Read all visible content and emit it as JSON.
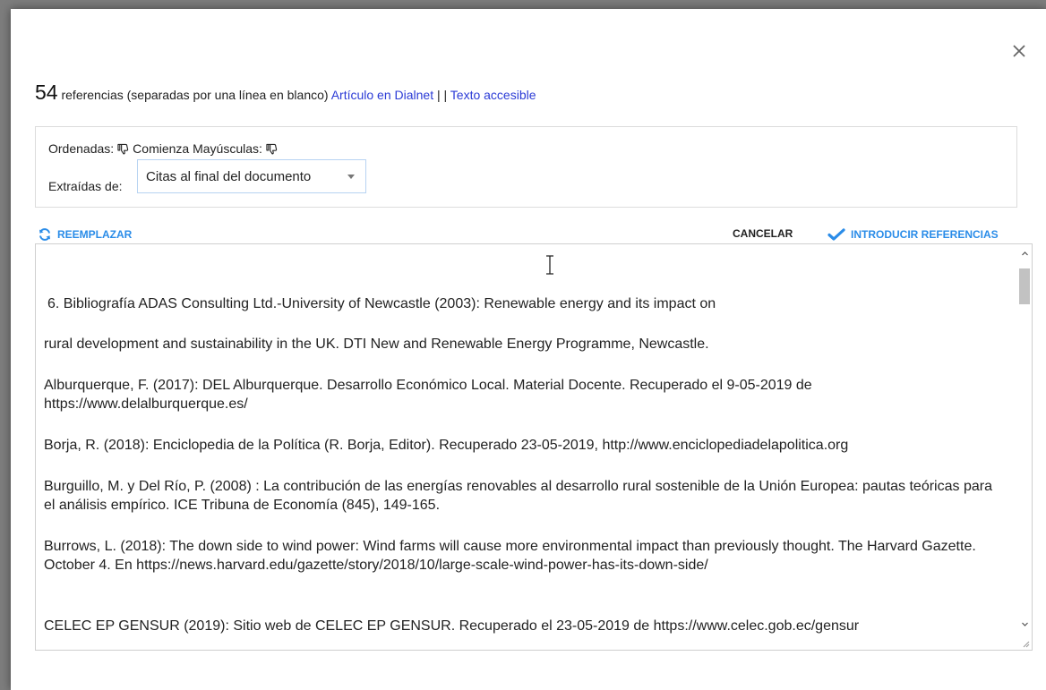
{
  "header": {
    "count": "54",
    "description": " referencias (separadas por una línea en blanco) ",
    "link_dialnet": "Artículo en Dialnet",
    "separator": " | | ",
    "link_accessible": "Texto accesible"
  },
  "options": {
    "sorted_label": "Ordenadas:",
    "capitals_label": "Comienza Mayúsculas:",
    "extracted_label": "Extraídas de:",
    "extracted_selected": "Citas al final del documento"
  },
  "toolbar": {
    "replace_label": "REEMPLAZAR",
    "cancel_label": "CANCELAR",
    "insert_label": "INTRODUCIR REFERENCIAS"
  },
  "icons": {
    "close": "close-icon",
    "thumbs_down": "thumbs-down-icon",
    "refresh": "refresh-icon",
    "check": "check-icon",
    "text_cursor": "text-cursor-icon"
  },
  "colors": {
    "accent": "#2a8ce8",
    "link": "#2b3bd6"
  },
  "references": [
    "6. Bibliografía ADAS Consulting Ltd.-University of Newcastle (2003): Renewable energy and its impact on",
    "rural development and sustainability in the UK. DTI New and Renewable Energy Programme, Newcastle.",
    "Alburquerque, F. (2017): DEL Alburquerque. Desarrollo Económico Local. Material Docente. Recuperado el 9-05-2019 de https://www.delalburquerque.es/",
    "Borja, R. (2018): Enciclopedia de la Política (R. Borja, Editor). Recuperado 23-05-2019, http://www.enciclopediadelapolitica.org",
    "Burguillo, M. y Del Río, P. (2008) : La contribución de las energías renovables al desarrollo rural sostenible de la Unión Europea: pautas teóricas para el análisis empírico. ICE Tribuna de Economía (845), 149-165.",
    "Burrows, L. (2018): The down side to wind power: Wind farms will cause more environmental impact than previously thought. The Harvard Gazette. October 4. En https://news.harvard.edu/gazette/story/2018/10/large-scale-wind-power-has-its-down-side/",
    "CELEC EP GENSUR (2019): Sitio web de CELEC EP GENSUR. Recuperado el 23-05-2019 de https://www.celec.gob.ec/gensur"
  ]
}
